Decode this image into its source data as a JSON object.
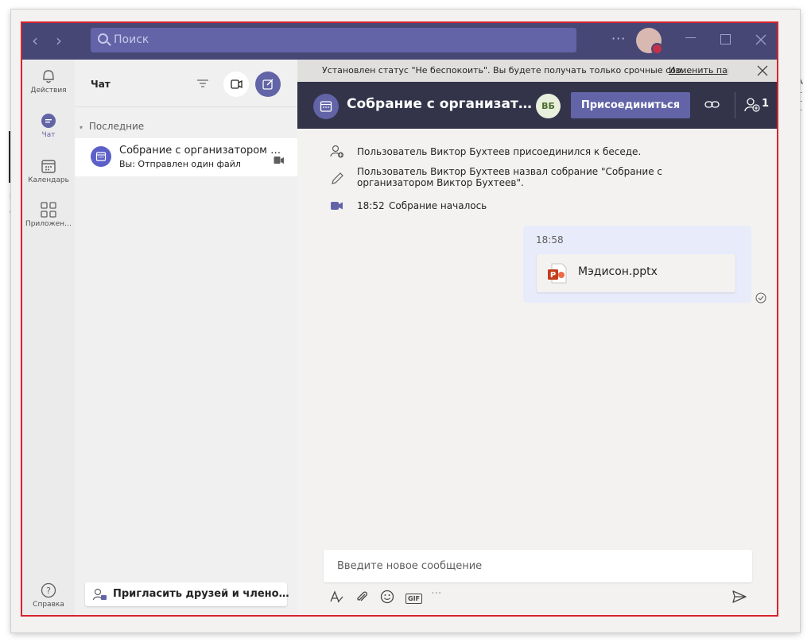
{
  "window": {
    "search_placeholder": "Поиск",
    "more_label": "···",
    "back_glyph": "‹",
    "forward_glyph": "›"
  },
  "rail": {
    "items": [
      {
        "label": "Действия",
        "icon": "bell-icon"
      },
      {
        "label": "Чат",
        "icon": "chat-icon"
      },
      {
        "label": "Календарь",
        "icon": "calendar-icon"
      },
      {
        "label": "Приложен…",
        "icon": "apps-icon"
      },
      {
        "label": "Справка",
        "icon": "help-icon"
      }
    ]
  },
  "chatlist": {
    "title": "Чат",
    "section": "Последние",
    "items": [
      {
        "title": "Собрание с организатором …",
        "subtitle": "Вы: Отправлен один файл"
      }
    ],
    "invite_label": "Пригласить друзей и члено…"
  },
  "banner": {
    "text": "Установлен статус \"Не беспокоить\". Вы будете получать только срочные соо…",
    "link": "Изменить пар"
  },
  "chat": {
    "title": "Собрание с организат…",
    "participant_initials": "ВБ",
    "join_label": "Присоединиться",
    "participants_count": "1"
  },
  "events": [
    {
      "text": "Пользователь Виктор Бухтеев присоединился к беседе.",
      "icon": "person-add-icon"
    },
    {
      "text": "Пользователь Виктор Бухтеев назвал собрание \"Собрание с организатором Виктор Бухтеев\".",
      "icon": "pencil-icon"
    },
    {
      "time": "18:52",
      "text": "Собрание началось",
      "icon": "video-icon"
    }
  ],
  "message": {
    "time": "18:58",
    "file_name": "Мэдисон.pptx"
  },
  "compose": {
    "placeholder": "Введите новое сообщение",
    "gif_label": "GIF",
    "more_label": "···"
  },
  "background": {
    "left_fragments": [
      "р",
      "1",
      "01",
      "…"
    ],
    "right_fragments": [
      "р",
      "1",
      "1",
      "2"
    ],
    "far_right": [
      "А",
      "1",
      "1",
      "1",
      "1"
    ]
  },
  "colors": {
    "titlebar": "#464775",
    "accent": "#6264a7",
    "chat_header": "#33344a",
    "highlight_border": "#d9232d",
    "bubble": "#e8ebfa"
  }
}
